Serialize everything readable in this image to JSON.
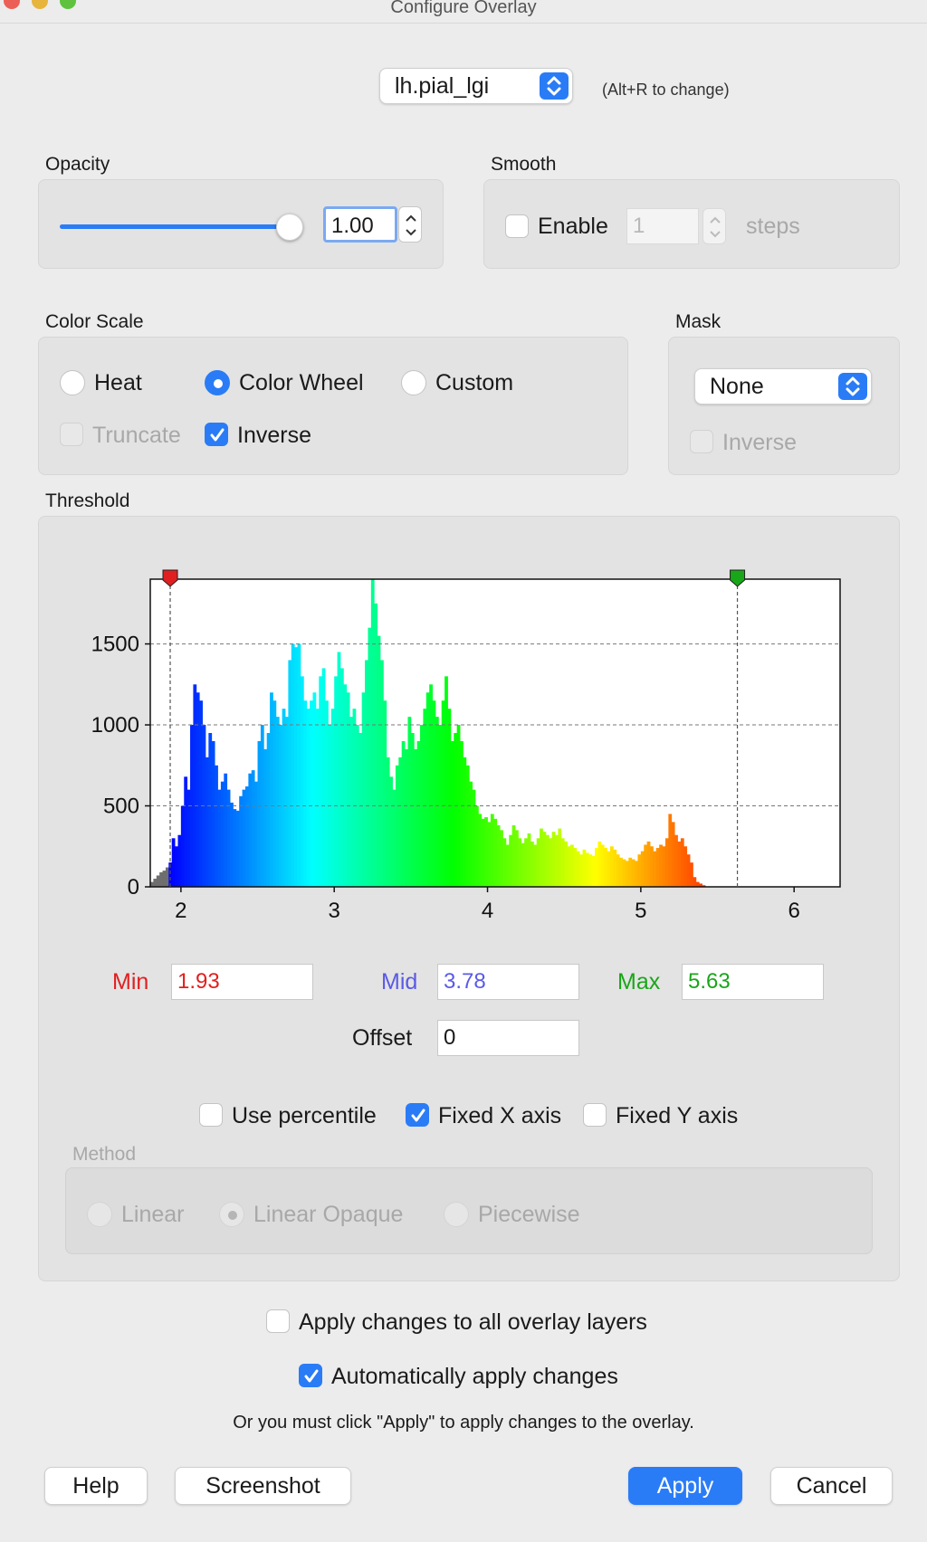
{
  "window": {
    "title": "Configure Overlay",
    "traffic_lights": [
      "#ec5f57",
      "#e7b53c",
      "#5fc23f"
    ]
  },
  "layer_select": {
    "value": "lh.pial_lgi",
    "hint": "(Alt+R to change)"
  },
  "opacity": {
    "label": "Opacity",
    "value": "1.00",
    "slider_fraction": 1.0
  },
  "smooth": {
    "label": "Smooth",
    "enable_label": "Enable",
    "enabled": false,
    "value": "1",
    "unit": "steps"
  },
  "color_scale": {
    "label": "Color Scale",
    "options": [
      "Heat",
      "Color Wheel",
      "Custom"
    ],
    "selected": "Color Wheel",
    "truncate_label": "Truncate",
    "truncate_checked": false,
    "inverse_label": "Inverse",
    "inverse_checked": true
  },
  "mask": {
    "label": "Mask",
    "value": "None",
    "inverse_label": "Inverse",
    "inverse_checked": false
  },
  "threshold": {
    "label": "Threshold",
    "min_label": "Min",
    "min_value": "1.93",
    "mid_label": "Mid",
    "mid_value": "3.78",
    "max_label": "Max",
    "max_value": "5.63",
    "offset_label": "Offset",
    "offset_value": "0",
    "use_percentile_label": "Use percentile",
    "use_percentile": false,
    "fixed_x_label": "Fixed X axis",
    "fixed_x": true,
    "fixed_y_label": "Fixed Y axis",
    "fixed_y": false,
    "colors": {
      "min": "#e02020",
      "mid": "#5a5ae6",
      "max": "#19a619"
    }
  },
  "method": {
    "label": "Method",
    "options": [
      "Linear",
      "Linear Opaque",
      "Piecewise"
    ],
    "selected": "Linear Opaque",
    "enabled": false
  },
  "apply_all": {
    "label": "Apply changes to all overlay layers",
    "checked": false
  },
  "auto_apply": {
    "label": "Automatically apply changes",
    "checked": true
  },
  "note": "Or you must click \"Apply\" to apply changes to the overlay.",
  "buttons": {
    "help": "Help",
    "screenshot": "Screenshot",
    "apply": "Apply",
    "cancel": "Cancel"
  },
  "chart_data": {
    "type": "bar",
    "xlim": [
      1.8,
      6.3
    ],
    "ylim": [
      0,
      1900
    ],
    "xticks": [
      2,
      3,
      4,
      5,
      6
    ],
    "yticks": [
      0,
      500,
      1000,
      1500
    ],
    "grid": "dashed horizontal",
    "threshold_markers": [
      {
        "x": 1.93,
        "color": "#e02020"
      },
      {
        "x": 5.63,
        "color": "#19a619"
      }
    ],
    "bin_width": 0.02,
    "x_start": 1.8,
    "values": [
      30,
      50,
      70,
      90,
      100,
      120,
      150,
      300,
      250,
      320,
      500,
      680,
      600,
      1000,
      1250,
      1200,
      1150,
      1000,
      800,
      950,
      900,
      750,
      600,
      650,
      700,
      600,
      520,
      480,
      470,
      560,
      600,
      620,
      700,
      720,
      650,
      900,
      1000,
      850,
      950,
      1200,
      1150,
      1050,
      1000,
      1100,
      1050,
      1400,
      1500,
      1480,
      1500,
      1300,
      1150,
      1100,
      1150,
      1200,
      1100,
      1300,
      1350,
      1150,
      1000,
      1100,
      1300,
      1450,
      1350,
      1250,
      1200,
      1050,
      1100,
      1000,
      950,
      1200,
      1400,
      1600,
      1900,
      1750,
      1550,
      1400,
      1150,
      800,
      680,
      600,
      750,
      800,
      900,
      850,
      1050,
      950,
      850,
      900,
      1000,
      1100,
      1200,
      1250,
      1150,
      1050,
      1000,
      1150,
      1300,
      1100,
      900,
      950,
      1000,
      900,
      800,
      750,
      650,
      600,
      500,
      450,
      420,
      430,
      400,
      450,
      420,
      380,
      350,
      300,
      260,
      320,
      380,
      350,
      300,
      270,
      300,
      330,
      280,
      260,
      300,
      360,
      340,
      320,
      300,
      340,
      320,
      360,
      300,
      280,
      250,
      260,
      240,
      220,
      200,
      230,
      210,
      200,
      190,
      240,
      280,
      260,
      240,
      220,
      250,
      230,
      200,
      180,
      170,
      160,
      180,
      170,
      160,
      200,
      220,
      260,
      280,
      250,
      220,
      240,
      260,
      250,
      300,
      450,
      400,
      320,
      280,
      300,
      250,
      200,
      150,
      60,
      30,
      20,
      10
    ]
  }
}
